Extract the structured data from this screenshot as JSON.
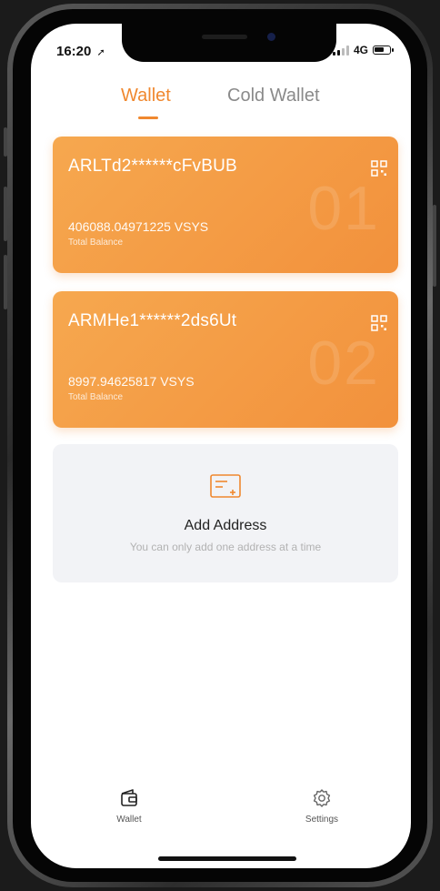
{
  "status_bar": {
    "time": "16:20",
    "network": "4G"
  },
  "tabs": [
    {
      "label": "Wallet",
      "active": true
    },
    {
      "label": "Cold Wallet",
      "active": false
    }
  ],
  "wallets": [
    {
      "address": "ARLTd2******cFvBUB",
      "balance": "406088.04971225 VSYS",
      "balance_label": "Total Balance",
      "index": "01"
    },
    {
      "address": "ARMHe1******2ds6Ut",
      "balance": "8997.94625817 VSYS",
      "balance_label": "Total Balance",
      "index": "02"
    }
  ],
  "add_address": {
    "title": "Add Address",
    "subtitle": "You can only add one address at a time"
  },
  "bottom_nav": [
    {
      "label": "Wallet",
      "icon": "wallet-icon"
    },
    {
      "label": "Settings",
      "icon": "gear-icon"
    }
  ],
  "colors": {
    "accent": "#f0882f",
    "card_start": "#f6a84f",
    "card_end": "#f2913c"
  }
}
